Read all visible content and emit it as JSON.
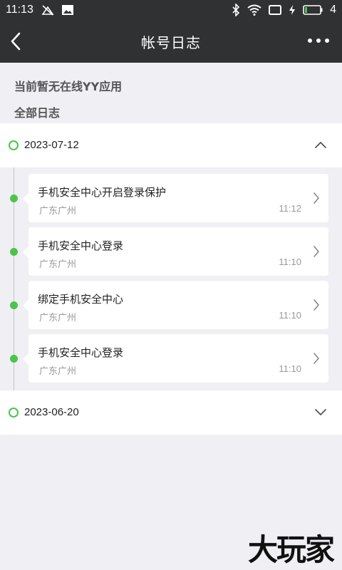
{
  "status_bar": {
    "time": "11:13",
    "battery_level": "4"
  },
  "nav": {
    "title": "帐号日志"
  },
  "notice": {
    "no_online_apps": "当前暂无在线YY应用",
    "all_logs": "全部日志"
  },
  "groups": [
    {
      "date": "2023-07-12",
      "expanded": true,
      "entries": [
        {
          "title": "手机安全中心开启登录保护",
          "location": "广东广州",
          "time": "11:12"
        },
        {
          "title": "手机安全中心登录",
          "location": "广东广州",
          "time": "11:10"
        },
        {
          "title": "绑定手机安全中心",
          "location": "广东广州",
          "time": "11:10"
        },
        {
          "title": "手机安全中心登录",
          "location": "广东广州",
          "time": "11:10"
        }
      ]
    },
    {
      "date": "2023-06-20",
      "expanded": false,
      "entries": []
    }
  ],
  "watermark": "大玩家",
  "colors": {
    "header_bg": "#2f3133",
    "page_bg": "#efeff4",
    "accent_green": "#4cc44a"
  }
}
